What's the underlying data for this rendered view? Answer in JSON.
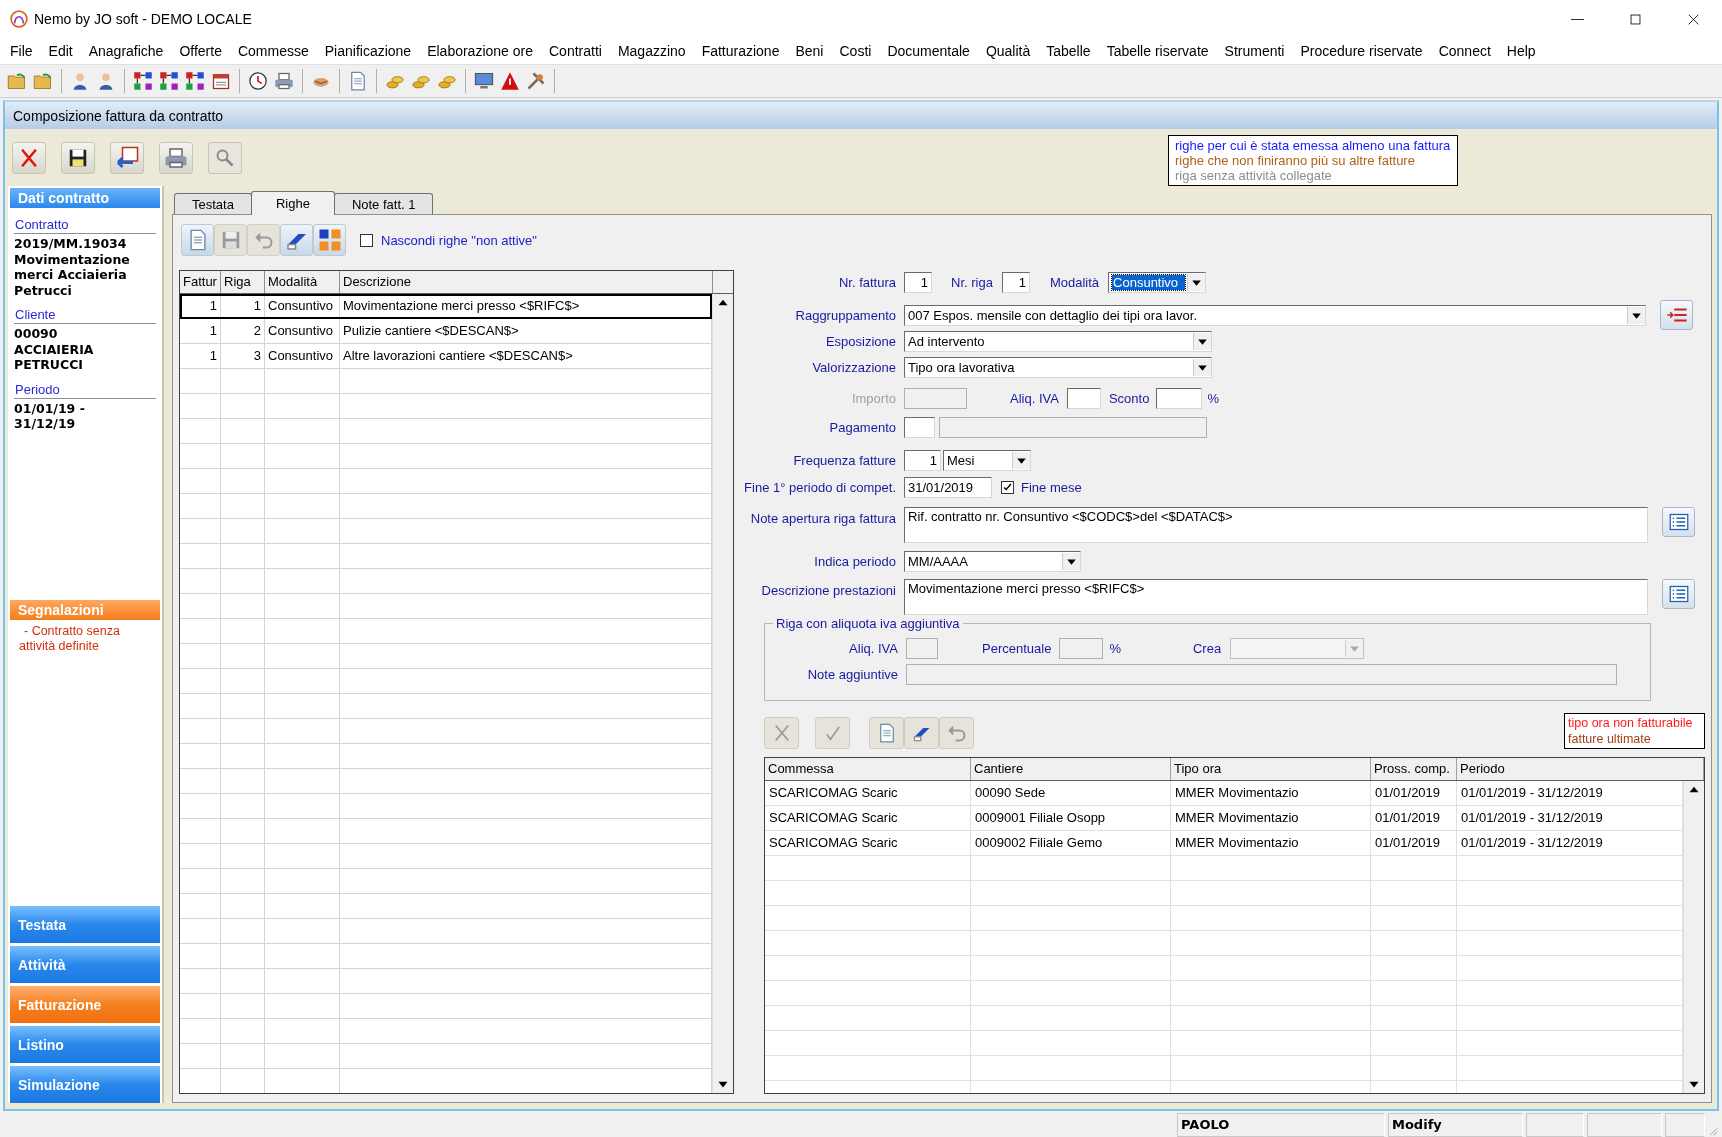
{
  "window": {
    "title": "Nemo by JO soft - DEMO LOCALE"
  },
  "menu": [
    "File",
    "Edit",
    "Anagrafiche",
    "Offerte",
    "Commesse",
    "Pianificazione",
    "Elaborazione ore",
    "Contratti",
    "Magazzino",
    "Fatturazione",
    "Beni",
    "Costi",
    "Documentale",
    "Qualità",
    "Tabelle",
    "Tabelle riservate",
    "Strumenti",
    "Procedure riservate",
    "Connect",
    "Help"
  ],
  "child_window": {
    "title": "Composizione fattura da contratto"
  },
  "legend": [
    {
      "text": "righe per cui è stata emessa almeno una fattura",
      "color": "#1a1aff"
    },
    {
      "text": "righe che non finiranno più su altre fatture",
      "color": "#b0601a"
    },
    {
      "text": "riga senza attività collegate",
      "color": "#8c8c8c"
    }
  ],
  "sidebar": {
    "header": "Dati contratto",
    "fields": [
      {
        "label": "Contratto",
        "lines": [
          "2019/MM.19034",
          "Movimentazione",
          "merci Acciaieria",
          "Petrucci"
        ]
      },
      {
        "label": "Cliente",
        "lines": [
          "00090",
          "ACCIAIERIA",
          "PETRUCCI"
        ]
      },
      {
        "label": "Periodo",
        "lines": [
          "01/01/19 -",
          "31/12/19"
        ]
      }
    ],
    "alerts_header": "Segnalazioni",
    "alerts": [
      "- Contratto senza attività definite"
    ]
  },
  "nav": [
    {
      "label": "Testata",
      "selected": false
    },
    {
      "label": "Attività",
      "selected": false
    },
    {
      "label": "Fatturazione",
      "selected": true
    },
    {
      "label": "Listino",
      "selected": false
    },
    {
      "label": "Simulazione",
      "selected": false
    }
  ],
  "tabs": [
    {
      "label": "Testata",
      "selected": false
    },
    {
      "label": "Righe",
      "selected": true
    },
    {
      "label": "Note fatt. 1",
      "selected": false
    }
  ],
  "hide_inactive": {
    "label": "Nascondi righe \"non attive\"",
    "checked": false
  },
  "rows_table": {
    "columns": [
      "Fattur",
      "Riga",
      "Modalità",
      "Descrizione"
    ],
    "rows": [
      {
        "cells": [
          "1",
          "1",
          "Consuntivo",
          "Movimentazione merci presso <$RIFC$>"
        ],
        "selected": true
      },
      {
        "cells": [
          "1",
          "2",
          "Consuntivo",
          "Pulizie cantiere <$DESCAN$>"
        ],
        "selected": false
      },
      {
        "cells": [
          "1",
          "3",
          "Consuntivo",
          "Altre lavorazioni cantiere <$DESCAN$>"
        ],
        "selected": false
      }
    ]
  },
  "form": {
    "nr_fattura": {
      "label": "Nr. fattura",
      "value": "1"
    },
    "nr_riga": {
      "label": "Nr. riga",
      "value": "1"
    },
    "modalita": {
      "label": "Modalità",
      "value": "Consuntivo",
      "highlighted": true
    },
    "raggruppamento": {
      "label": "Raggruppamento",
      "value": "007 Espos. mensile con dettaglio dei tipi ora lavor."
    },
    "esposizione": {
      "label": "Esposizione",
      "value": "Ad intervento"
    },
    "valorizzazione": {
      "label": "Valorizzazione",
      "value": "Tipo ora lavorativa"
    },
    "importo": {
      "label": "Importo",
      "disabled": true
    },
    "aliq_iva": {
      "label": "Aliq. IVA"
    },
    "sconto": {
      "label": "Sconto",
      "unit": "%"
    },
    "pagamento": {
      "label": "Pagamento"
    },
    "frequenza": {
      "label": "Frequenza fatture",
      "value": "1",
      "unit": "Mesi"
    },
    "fine_periodo": {
      "label": "Fine 1° periodo di compet.",
      "value": "31/01/2019"
    },
    "fine_mese": {
      "label": "Fine mese",
      "checked": true
    },
    "note_apertura": {
      "label": "Note apertura riga fattura",
      "value": "Rif. contratto nr. Consuntivo <$CODC$>del <$DATAC$>"
    },
    "indica_periodo": {
      "label": "Indica periodo",
      "value": "MM/AAAA"
    },
    "descrizione": {
      "label": "Descrizione prestazioni",
      "value": "Movimentazione merci presso <$RIFC$>"
    }
  },
  "extra_vat": {
    "title": "Riga con aliquota iva aggiuntiva",
    "aliq_label": "Aliq. IVA",
    "perc_label": "Percentuale",
    "perc_unit": "%",
    "crea_label": "Crea",
    "note_label": "Note aggiuntive"
  },
  "legend2": [
    {
      "text": "tipo ora non fatturabile",
      "color": "#ff1a1a"
    },
    {
      "text": "fatture ultimate",
      "color": "#a0401a"
    }
  ],
  "activities_table": {
    "columns": [
      "Commessa",
      "Cantiere",
      "Tipo ora",
      "Pross. comp.",
      "Periodo"
    ],
    "rows": [
      {
        "cells": [
          "SCARICOMAG Scaric",
          "00090 Sede",
          "MMER Movimentazio",
          "01/01/2019",
          "01/01/2019 - 31/12/2019"
        ]
      },
      {
        "cells": [
          "SCARICOMAG Scaric",
          "0009001 Filiale Osopp",
          "MMER Movimentazio",
          "01/01/2019",
          "01/01/2019 - 31/12/2019"
        ]
      },
      {
        "cells": [
          "SCARICOMAG Scaric",
          "0009002 Filiale Gemo",
          "MMER Movimentazio",
          "01/01/2019",
          "01/01/2019 - 31/12/2019"
        ]
      }
    ]
  },
  "status_bar": [
    "PAOLO",
    "Modify"
  ]
}
